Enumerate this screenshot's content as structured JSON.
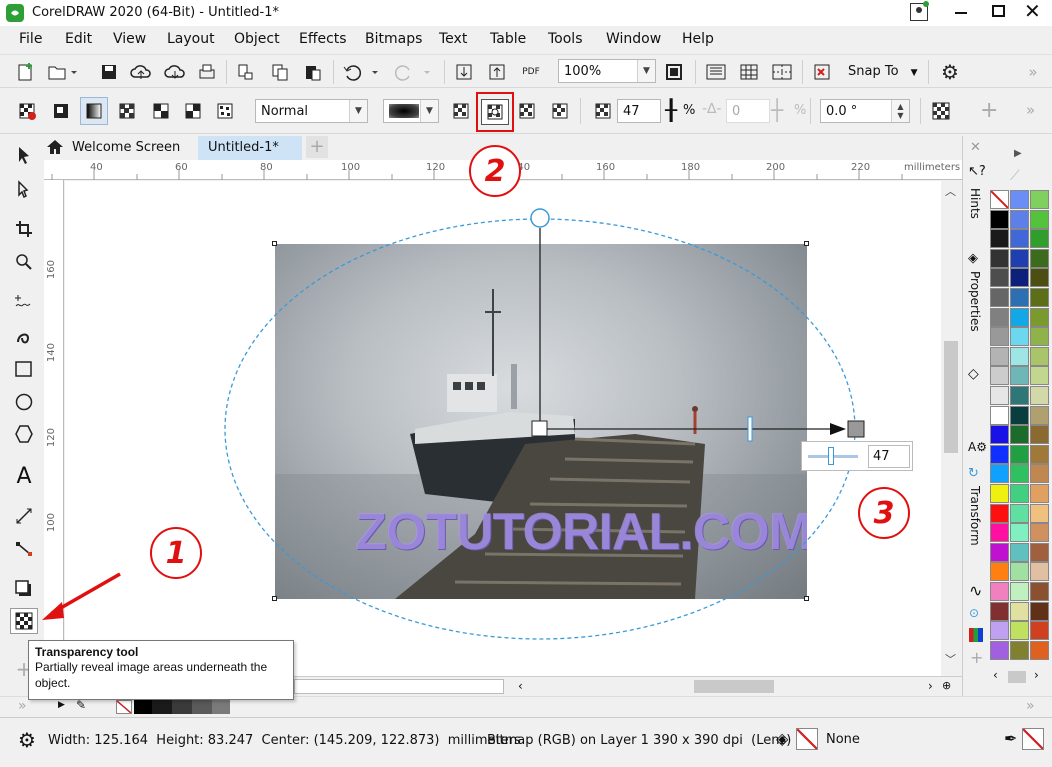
{
  "window": {
    "title": "CorelDRAW 2020 (64-Bit) - Untitled-1*",
    "controls": [
      "minimize",
      "maximize",
      "close"
    ]
  },
  "menu": [
    "File",
    "Edit",
    "View",
    "Layout",
    "Object",
    "Effects",
    "Bitmaps",
    "Text",
    "Table",
    "Tools",
    "Window",
    "Help"
  ],
  "std_toolbar": {
    "zoom": "100%",
    "snap_to": "Snap To",
    "pdf_label": "PDF"
  },
  "property_bar": {
    "merge_mode": "Normal",
    "transparency_value": "47",
    "percent_sign": "%",
    "feather_value": "0",
    "feather_percent": "%",
    "angle": "0.0 °"
  },
  "tabs": {
    "welcome": "Welcome Screen",
    "doc": "Untitled-1*",
    "add": "+"
  },
  "ruler": {
    "units": "millimeters",
    "top_ticks": [
      "40",
      "60",
      "80",
      "100",
      "120",
      "140",
      "160",
      "180",
      "200",
      "220"
    ],
    "left_ticks": [
      "160",
      "140",
      "120",
      "100"
    ]
  },
  "canvas": {
    "watermark": "ZOTUTORIAL.COM",
    "transparency_slider_value": "47"
  },
  "annotations": [
    "1",
    "2",
    "3"
  ],
  "tooltip": {
    "title": "Transparency tool",
    "body": "Partially reveal image areas underneath the object."
  },
  "dockers": [
    "Hints",
    "Properties",
    "Transform"
  ],
  "status": {
    "dimensions": "Width: 125.164  Height: 83.247  Center: (145.209, 122.873)  millimeters",
    "object_info": "Bitmap (RGB) on Layer 1 390 x 390 dpi  (Lens)",
    "fill": "None"
  },
  "colors": {
    "accent_red": "#e01010",
    "selection_blue": "#3a9ad9",
    "tab_active": "#cfe3f7"
  },
  "palette": [
    [
      "none",
      "#6a8ef5",
      "#7fd05f"
    ],
    [
      "#000000",
      "#5f7fe8",
      "#55c23c"
    ],
    [
      "#1a1a1a",
      "#4068d8",
      "#2f9e2a"
    ],
    [
      "#333333",
      "#1f3fb0",
      "#3d6b1e"
    ],
    [
      "#4d4d4d",
      "#0c1f7a",
      "#4d4f12"
    ],
    [
      "#666666",
      "#2c6fb3",
      "#5d6e18"
    ],
    [
      "#808080",
      "#12a8e8",
      "#7a9a2e"
    ],
    [
      "#999999",
      "#6bd8f0",
      "#8fb24a"
    ],
    [
      "#b3b3b3",
      "#9ee5e5",
      "#aac46a"
    ],
    [
      "#cccccc",
      "#6fb7b7",
      "#c2d690"
    ],
    [
      "#e6e6e6",
      "#2f7676",
      "#d2d8a8"
    ],
    [
      "#ffffff",
      "#0a3d3d",
      "#b0a070"
    ],
    [
      "#1a10e8",
      "#1b6b2b",
      "#8a6a30"
    ],
    [
      "#1030ff",
      "#20a040",
      "#a07838"
    ],
    [
      "#10a0ff",
      "#2fc060",
      "#c08850"
    ],
    [
      "#f0f010",
      "#40d080",
      "#e0a060"
    ],
    [
      "#ff1010",
      "#60e0a0",
      "#f0c080"
    ],
    [
      "#ff10a0",
      "#80f0c0",
      "#d09060"
    ],
    [
      "#c010d0",
      "#60c0c0",
      "#a06040"
    ],
    [
      "#ff8010",
      "#a0e0a0",
      "#e0c0a0"
    ],
    [
      "#f080c0",
      "#c0f0c0",
      "#8a5030"
    ],
    [
      "#803030",
      "#e0e0a0",
      "#603018"
    ],
    [
      "#c0a0f0",
      "#c0e060",
      "#d04020"
    ],
    [
      "#a060e0",
      "#808030",
      "#e06020"
    ]
  ]
}
